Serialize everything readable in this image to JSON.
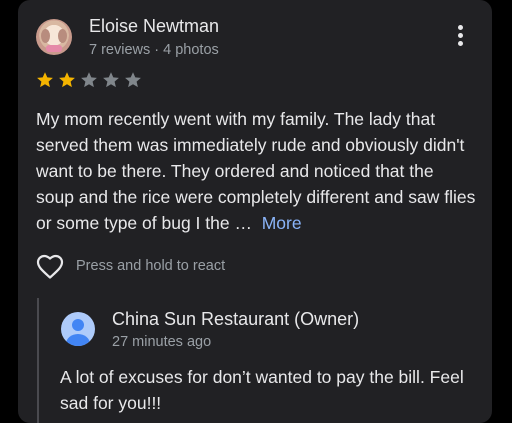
{
  "review": {
    "reviewer_name": "Eloise Newtman",
    "reviewer_meta": "7 reviews · 4 photos",
    "rating": 2,
    "rating_max": 5,
    "text": "My mom recently went with my family. The lady that served them was immediately rude and obviously didn't want to be there. They ordered and noticed that the soup and the rice were completely different and saw flies or some type of bug I the …",
    "more_label": "More",
    "react_label": "Press and hold to react",
    "more_options_icon": "more-vert-icon",
    "react_icon": "heart-outline-icon"
  },
  "owner_reply": {
    "name": "China Sun Restaurant (Owner)",
    "time": "27 minutes ago",
    "text": "A lot of excuses for don’t wanted to pay the bill. Feel sad for you!!!"
  },
  "colors": {
    "background": "#000000",
    "card": "#212124",
    "text_primary": "#e8e8ea",
    "text_secondary": "#9aa0a6",
    "star_filled": "#f4b400",
    "star_empty": "#80868b",
    "link": "#8ab4f8"
  }
}
